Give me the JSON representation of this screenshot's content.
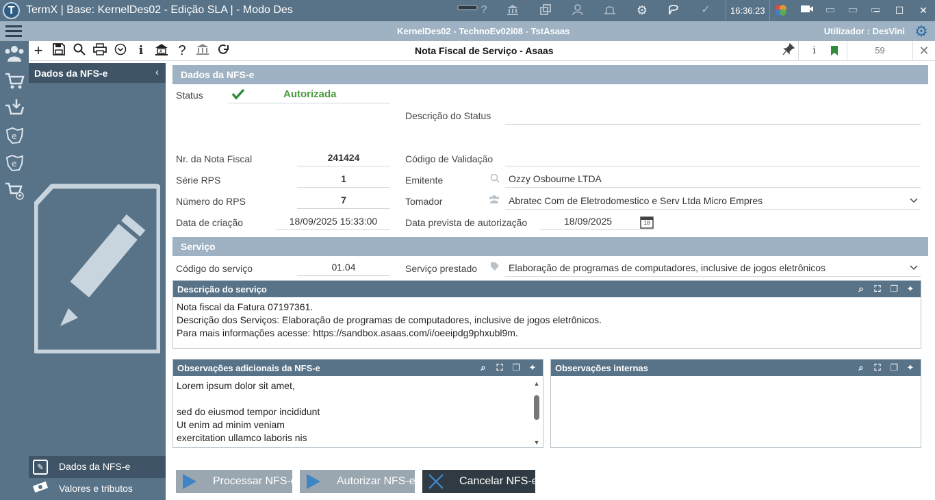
{
  "window": {
    "title": "TermX | Base: KernelDes02 - Edição SLA | - Modo Des",
    "clock": "16:36:23"
  },
  "infobar": {
    "context": "KernelDes02 - TechnoEv02i08 - TstAsaas",
    "user_label": "Utilizador :",
    "user_name": "DesVini"
  },
  "toolbar": {
    "title": "Nota Fiscal de Serviço - Asaas",
    "info_label": "i",
    "record_count": "59"
  },
  "sidepanel": {
    "header": "Dados da NFS-e",
    "nav": [
      {
        "label": "Dados da NFS-e"
      },
      {
        "label": "Valores e tributos"
      }
    ]
  },
  "sections": {
    "dados": "Dados da NFS-e",
    "servico": "Serviço"
  },
  "form": {
    "status_label": "Status",
    "status_value": "Autorizada",
    "status_desc_label": "Descrição do Status",
    "status_desc_value": "",
    "nr_nota_label": "Nr. da Nota Fiscal",
    "nr_nota_value": "241424",
    "cod_validacao_label": "Código de Validação",
    "cod_validacao_value": "",
    "serie_label": "Série RPS",
    "serie_value": "1",
    "emitente_label": "Emitente",
    "emitente_value": "Ozzy Osbourne LTDA",
    "numero_rps_label": "Número do RPS",
    "numero_rps_value": "7",
    "tomador_label": "Tomador",
    "tomador_value": "Abratec Com de Eletrodomestico e Serv Ltda Micro Empres",
    "data_criacao_label": "Data de criação",
    "data_criacao_value": "18/09/2025 15:33:00",
    "data_prevista_label": "Data prevista de autorização",
    "data_prevista_value": "18/09/2025",
    "calendar_day": "18",
    "cod_servico_label": "Código do serviço",
    "cod_servico_value": "01.04",
    "servico_prestado_label": "Serviço prestado",
    "servico_prestado_value": "Elaboração de programas de computadores, inclusive de jogos eletrônicos"
  },
  "descricao": {
    "title": "Descrição do serviço",
    "lines": [
      "Nota fiscal da Fatura 07197361.",
      "Descrição dos Serviços: Elaboração de programas de computadores, inclusive de jogos eletrônicos.",
      "Para mais informações acesse: https://sandbox.asaas.com/i/oeeipdg9phxubl9m."
    ]
  },
  "observacoes": {
    "title": "Observações adicionais da NFS-e",
    "lines": [
      "Lorem ipsum dolor sit amet,",
      "",
      "sed do eiusmod tempor incididunt",
      "Ut enim ad minim veniam",
      "exercitation ullamco laboris nis"
    ],
    "scroll_position": 0.3
  },
  "observacoes_internas": {
    "title": "Observações internas"
  },
  "buttons": {
    "processar": "Processar NFS-e",
    "autorizar": "Autorizar NFS-e",
    "cancelar": "Cancelar NFS-e"
  },
  "colors": {
    "titlebar": "#587287",
    "infobar": "#9eb2c3",
    "status_ok": "#4a9a3e",
    "button_disabled": "#9aa7b1",
    "button_cancel": "#2f3a42"
  },
  "icons": {
    "app": "T"
  }
}
